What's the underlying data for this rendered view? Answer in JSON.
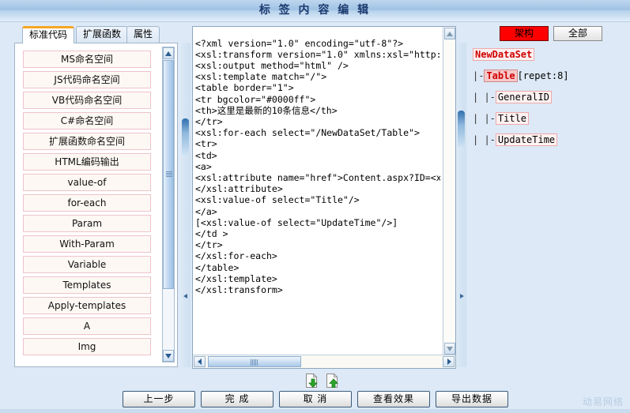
{
  "window": {
    "title": "标 签 内 容 编 辑"
  },
  "tabs": [
    {
      "label": "标准代码",
      "active": true
    },
    {
      "label": "扩展函数",
      "active": false
    },
    {
      "label": "属性",
      "active": false
    }
  ],
  "left_panel": {
    "buttons": [
      "MS命名空间",
      "JS代码命名空间",
      "VB代码命名空间",
      "C#命名空间",
      "扩展函数命名空间",
      "HTML编码输出",
      "value-of",
      "for-each",
      "Param",
      "With-Param",
      "Variable",
      "Templates",
      "Apply-templates",
      "A",
      "Img"
    ],
    "scrollbar": {
      "up": "▲",
      "down": "▼"
    }
  },
  "editor": {
    "code": "<?xml version=\"1.0\" encoding=\"utf-8\"?>\n<xsl:transform version=\"1.0\" xmlns:xsl=\"http://www.w\n<xsl:output method=\"html\" />\n<xsl:template match=\"/\">\n<table border=\"1\">\n<tr bgcolor=\"#0000ff\">\n<th>这里是最新的10条信息</th>\n</tr>\n<xsl:for-each select=\"/NewDataSet/Table\">\n<tr>\n<td>\n<a>\n<xsl:attribute name=\"href\">Content.aspx?ID=<xsl:valu\n</xsl:attribute>\n<xsl:value-of select=\"Title\"/>\n</a>\n[<xsl:value-of select=\"UpdateTime\"/>]\n</td >\n</tr>\n</xsl:for-each>\n</table>\n</xsl:template>\n</xsl:transform>",
    "hscroll": {
      "left_arrow": "❮",
      "right_arrow": "❯"
    }
  },
  "right_panel": {
    "schema_button": "架构",
    "all_button": "全部",
    "tree": [
      {
        "guide": "",
        "label": "NewDataSet",
        "suffix": "",
        "style": "root"
      },
      {
        "guide": "|-",
        "label": "Table",
        "suffix": "[repet:8]",
        "style": "sel"
      },
      {
        "guide": "|  |-",
        "label": "GeneralID",
        "suffix": "",
        "style": "leaf"
      },
      {
        "guide": "|  |-",
        "label": "Title",
        "suffix": "",
        "style": "leaf"
      },
      {
        "guide": "|  |-",
        "label": "UpdateTime",
        "suffix": "",
        "style": "leaf"
      }
    ]
  },
  "footer": {
    "icons": [
      {
        "name": "import-file-icon"
      },
      {
        "name": "export-file-icon"
      }
    ],
    "buttons": [
      {
        "id": "prev",
        "label": "上一步"
      },
      {
        "id": "finish",
        "label": "完  成"
      },
      {
        "id": "cancel",
        "label": "取  消"
      },
      {
        "id": "view",
        "label": "查看效果"
      },
      {
        "id": "export",
        "label": "导出数据"
      }
    ],
    "watermark": "动易网络"
  },
  "colors": {
    "title_bar": "#9fc2e4",
    "page_bg": "#dde9f6",
    "active_tab_accent": "#f5a623",
    "schema_btn_bg": "#ff0000",
    "tree_node_text": "#d00000",
    "code_btn_border": "#eec3cc"
  }
}
